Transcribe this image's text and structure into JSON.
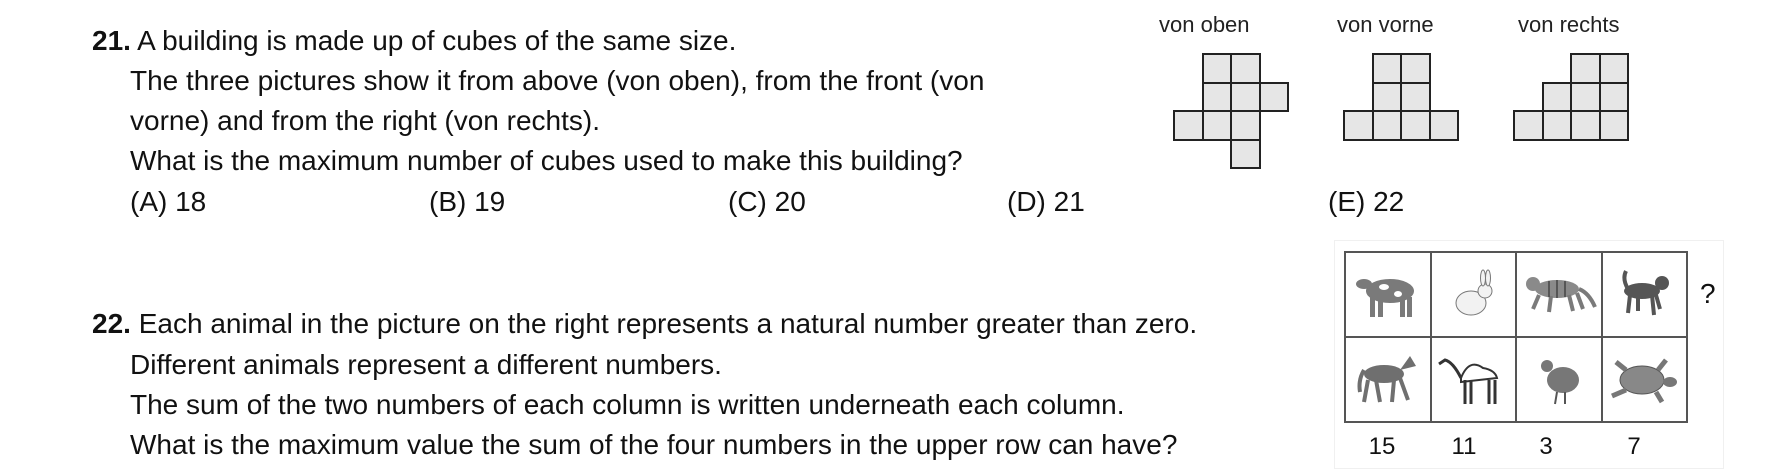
{
  "q21": {
    "number": "21.",
    "lines": [
      "A building is made up of cubes of the same size.",
      "The three pictures show it from above (von oben), from the front (von",
      "vorne) and from the right (von rechts).",
      "What is the maximum number of cubes used to make this building?"
    ],
    "options": [
      "(A) 18",
      "(B) 19",
      "(C) 20",
      "(D) 21",
      "(E) 22"
    ],
    "views": [
      {
        "label": "von oben"
      },
      {
        "label": "von vorne"
      },
      {
        "label": "von rechts"
      }
    ]
  },
  "q22": {
    "number": "22.",
    "lines": [
      "Each animal in the picture on the right represents a natural number greater than zero.",
      "Different animals represent a different numbers.",
      "The sum of the two numbers of each column is written underneath each column.",
      "What is the maximum value the sum of the four numbers in the upper row can have?"
    ],
    "upper_row": [
      "cow",
      "rabbit",
      "tiger",
      "dog"
    ],
    "lower_row": [
      "horse",
      "camel",
      "hen",
      "turtle"
    ],
    "row_mark": "?",
    "column_sums": [
      "15",
      "11",
      "3",
      "7"
    ]
  },
  "colors": {
    "cube_fill": "#e6e6e6",
    "animal_gray": "#7a7a7a"
  }
}
